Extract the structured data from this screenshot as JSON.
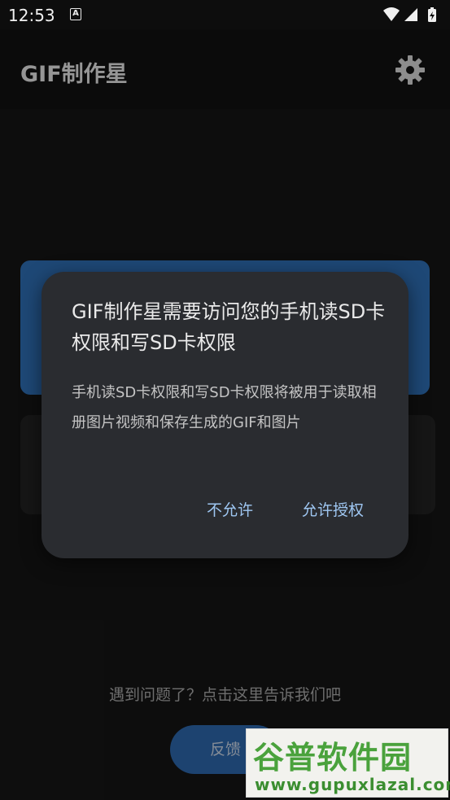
{
  "status_bar": {
    "time": "12:53",
    "notification_icon_letter": "A"
  },
  "app_bar": {
    "title": "GIF制作星",
    "settings_icon": "gear-icon"
  },
  "background": {
    "help_text": "遇到问题了？点击这里告诉我们吧",
    "feedback_label": "反馈"
  },
  "dialog": {
    "title": "GIF制作星需要访问您的手机读SD卡权限和写SD卡权限",
    "message": "手机读SD卡权限和写SD卡权限将被用于读取相册图片视频和保存生成的GIF和图片",
    "deny_label": "不允许",
    "allow_label": "允许授权"
  },
  "watermark": {
    "logo_text": "谷普软件园",
    "url": "www.gupuxlazal.com"
  },
  "colors": {
    "accent_blue": "#2f6fb6",
    "dialog_button_text": "#9fc7f2",
    "dialog_bg": "#2a2c30"
  }
}
